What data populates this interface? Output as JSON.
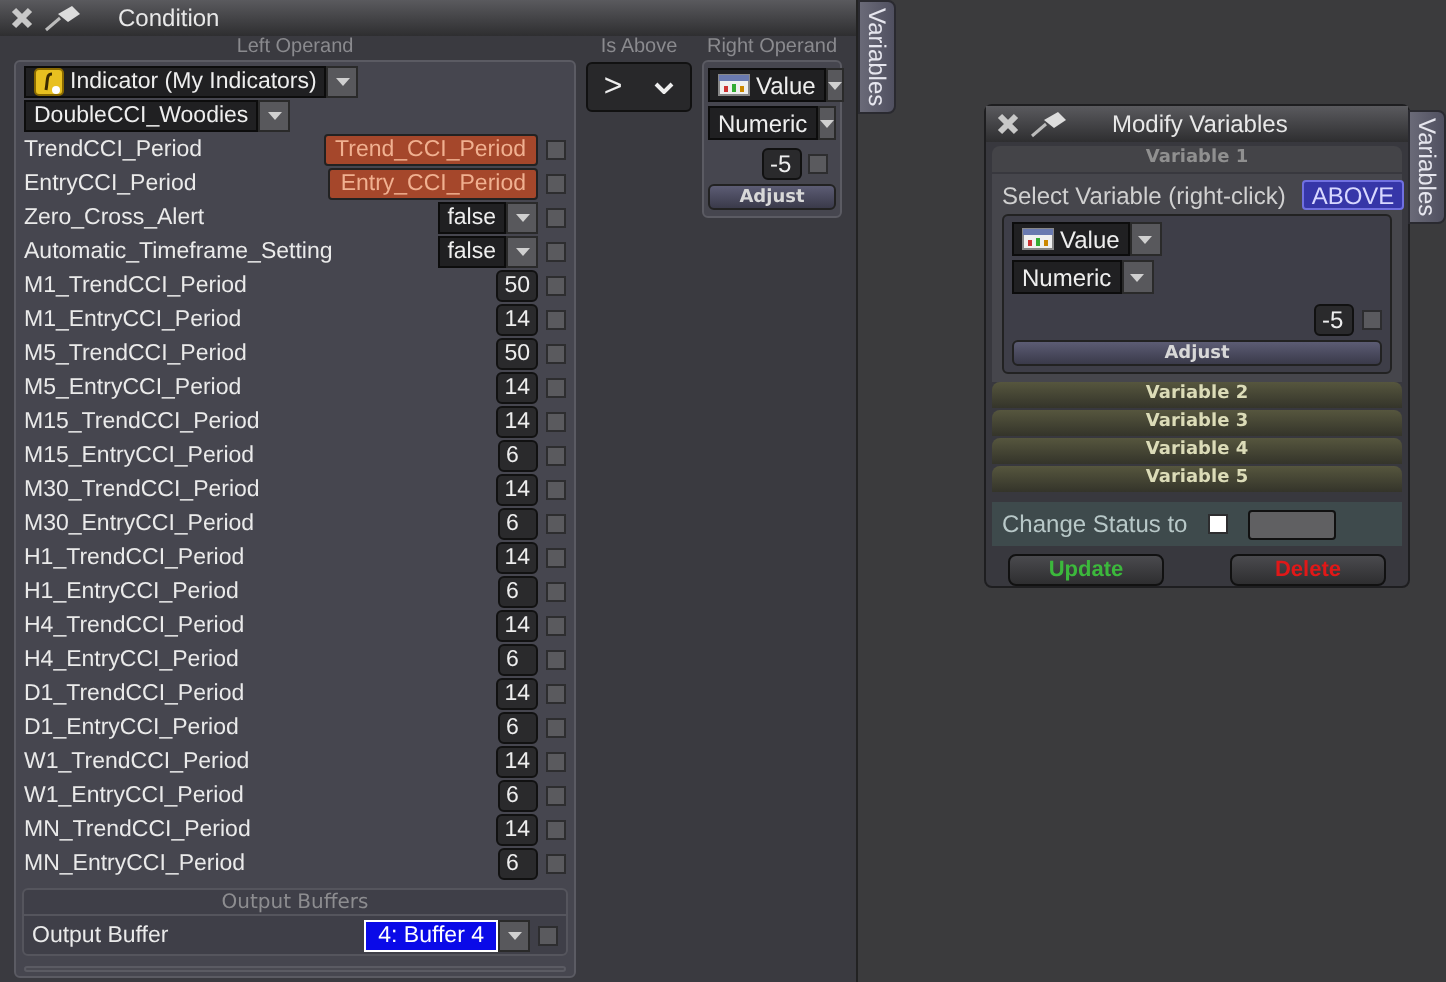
{
  "condition": {
    "title": "Condition",
    "left_operand": {
      "label": "Left Operand",
      "source": "Indicator (My Indicators)",
      "indicator": "DoubleCCI_Woodies",
      "params": [
        {
          "name": "TrendCCI_Period",
          "kind": "variable",
          "value": "Trend_CCI_Period",
          "checked": false
        },
        {
          "name": "EntryCCI_Period",
          "kind": "variable",
          "value": "Entry_CCI_Period",
          "checked": false
        },
        {
          "name": "Zero_Cross_Alert",
          "kind": "dropdown",
          "value": "false",
          "checked": false
        },
        {
          "name": "Automatic_Timeframe_Setting",
          "kind": "dropdown",
          "value": "false",
          "checked": false
        },
        {
          "name": "M1_TrendCCI_Period",
          "kind": "number",
          "value": "50",
          "checked": false
        },
        {
          "name": "M1_EntryCCI_Period",
          "kind": "number",
          "value": "14",
          "checked": false
        },
        {
          "name": "M5_TrendCCI_Period",
          "kind": "number",
          "value": "50",
          "checked": false
        },
        {
          "name": "M5_EntryCCI_Period",
          "kind": "number",
          "value": "14",
          "checked": false
        },
        {
          "name": "M15_TrendCCI_Period",
          "kind": "number",
          "value": "14",
          "checked": false
        },
        {
          "name": "M15_EntryCCI_Period",
          "kind": "number",
          "value": "6",
          "checked": false
        },
        {
          "name": "M30_TrendCCI_Period",
          "kind": "number",
          "value": "14",
          "checked": false
        },
        {
          "name": "M30_EntryCCI_Period",
          "kind": "number",
          "value": "6",
          "checked": false
        },
        {
          "name": "H1_TrendCCI_Period",
          "kind": "number",
          "value": "14",
          "checked": false
        },
        {
          "name": "H1_EntryCCI_Period",
          "kind": "number",
          "value": "6",
          "checked": false
        },
        {
          "name": "H4_TrendCCI_Period",
          "kind": "number",
          "value": "14",
          "checked": false
        },
        {
          "name": "H4_EntryCCI_Period",
          "kind": "number",
          "value": "6",
          "checked": false
        },
        {
          "name": "D1_TrendCCI_Period",
          "kind": "number",
          "value": "14",
          "checked": false
        },
        {
          "name": "D1_EntryCCI_Period",
          "kind": "number",
          "value": "6",
          "checked": false
        },
        {
          "name": "W1_TrendCCI_Period",
          "kind": "number",
          "value": "14",
          "checked": false
        },
        {
          "name": "W1_EntryCCI_Period",
          "kind": "number",
          "value": "6",
          "checked": false
        },
        {
          "name": "MN_TrendCCI_Period",
          "kind": "number",
          "value": "14",
          "checked": false
        },
        {
          "name": "MN_EntryCCI_Period",
          "kind": "number",
          "value": "6",
          "checked": false
        }
      ],
      "output_buffers": {
        "label": "Output Buffers",
        "name": "Output Buffer",
        "value": "4: Buffer 4",
        "checked": false
      }
    },
    "operator": {
      "label": "Is Above",
      "value": ">"
    },
    "right_operand": {
      "label": "Right Operand",
      "type": "Value",
      "subtype": "Numeric",
      "value": "-5",
      "checked": false,
      "adjust": "Adjust"
    },
    "side_tab": "Variables"
  },
  "modify_variables": {
    "title": "Modify Variables",
    "variables": [
      {
        "label": "Variable 1",
        "expanded": true,
        "select_label": "Select Variable (right-click)",
        "badge": "ABOVE",
        "type": "Value",
        "subtype": "Numeric",
        "value": "-5",
        "checked": false,
        "adjust": "Adjust"
      },
      {
        "label": "Variable 2",
        "expanded": false
      },
      {
        "label": "Variable 3",
        "expanded": false
      },
      {
        "label": "Variable 4",
        "expanded": false
      },
      {
        "label": "Variable 5",
        "expanded": false
      }
    ],
    "change_status": {
      "label": "Change Status to",
      "checked": false
    },
    "buttons": [
      {
        "label": "Update",
        "kind": "update"
      },
      {
        "label": "Delete",
        "kind": "delete"
      }
    ],
    "side_tab": "Variables"
  }
}
